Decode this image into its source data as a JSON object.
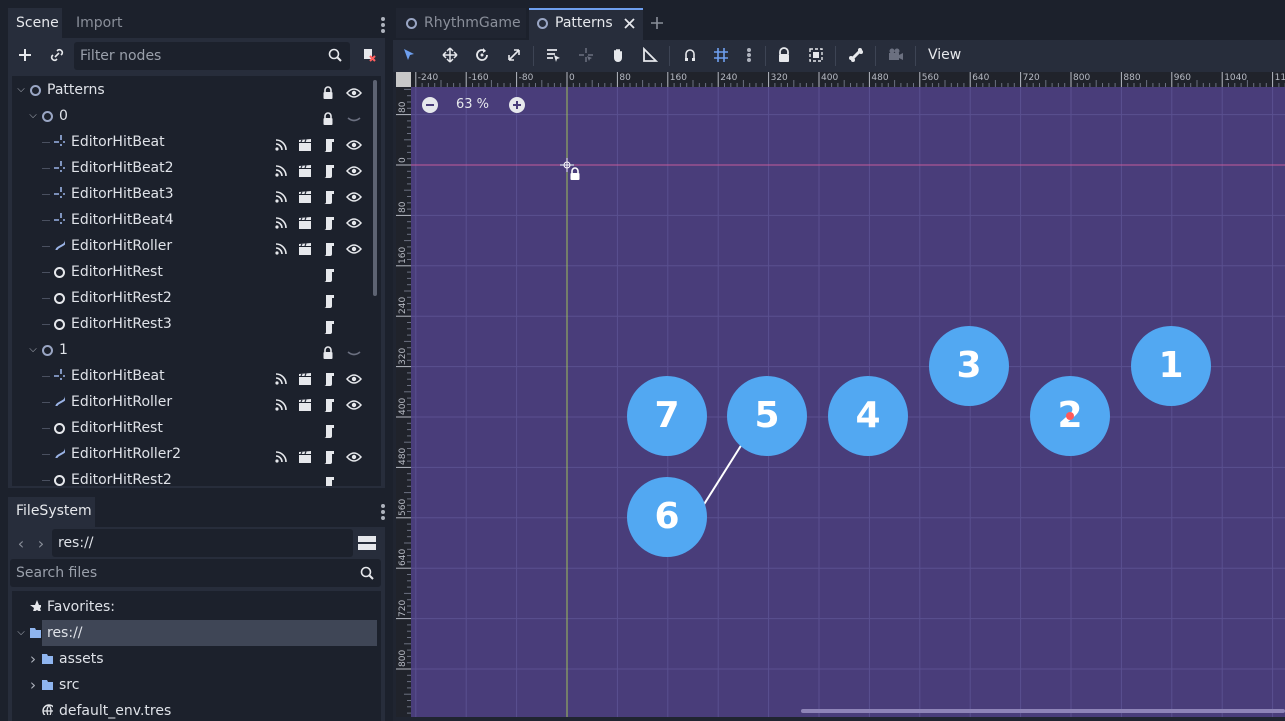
{
  "left_top_dock": {
    "tabs": [
      {
        "label": "Scene"
      },
      {
        "label": "Import"
      }
    ],
    "filter_placeholder": "Filter nodes",
    "tree": [
      {
        "label": "Patterns",
        "depth": 0,
        "caret": "down",
        "icon": "node2d-icon",
        "right_icons": [
          "lock-icon",
          "eye-icon"
        ]
      },
      {
        "label": "0",
        "depth": 1,
        "caret": "down",
        "icon": "node2d-icon",
        "right_icons": [
          "lock-icon",
          "hidden-eye-icon"
        ]
      },
      {
        "label": "EditorHitBeat",
        "depth": 2,
        "icon": "position2d-icon",
        "right_icons": [
          "signal-icon",
          "clapper-icon",
          "script-icon",
          "eye-icon"
        ]
      },
      {
        "label": "EditorHitBeat2",
        "depth": 2,
        "icon": "position2d-icon",
        "right_icons": [
          "signal-icon",
          "clapper-icon",
          "script-icon",
          "eye-icon"
        ]
      },
      {
        "label": "EditorHitBeat3",
        "depth": 2,
        "icon": "position2d-icon",
        "right_icons": [
          "signal-icon",
          "clapper-icon",
          "script-icon",
          "eye-icon"
        ]
      },
      {
        "label": "EditorHitBeat4",
        "depth": 2,
        "icon": "position2d-icon",
        "right_icons": [
          "signal-icon",
          "clapper-icon",
          "script-icon",
          "eye-icon"
        ]
      },
      {
        "label": "EditorHitRoller",
        "depth": 2,
        "icon": "path-icon",
        "right_icons": [
          "signal-icon",
          "clapper-icon",
          "script-icon",
          "eye-icon"
        ]
      },
      {
        "label": "EditorHitRest",
        "depth": 2,
        "icon": "node-icon",
        "right_icons": [
          "script-icon"
        ]
      },
      {
        "label": "EditorHitRest2",
        "depth": 2,
        "icon": "node-icon",
        "right_icons": [
          "script-icon"
        ]
      },
      {
        "label": "EditorHitRest3",
        "depth": 2,
        "icon": "node-icon",
        "right_icons": [
          "script-icon"
        ]
      },
      {
        "label": "1",
        "depth": 1,
        "caret": "down",
        "icon": "node2d-icon",
        "right_icons": [
          "lock-icon",
          "hidden-eye-icon"
        ]
      },
      {
        "label": "EditorHitBeat",
        "depth": 2,
        "icon": "position2d-icon",
        "right_icons": [
          "signal-icon",
          "clapper-icon",
          "script-icon",
          "eye-icon"
        ]
      },
      {
        "label": "EditorHitRoller",
        "depth": 2,
        "icon": "path-icon",
        "right_icons": [
          "signal-icon",
          "clapper-icon",
          "script-icon",
          "eye-icon"
        ]
      },
      {
        "label": "EditorHitRest",
        "depth": 2,
        "icon": "node-icon",
        "right_icons": [
          "script-icon"
        ]
      },
      {
        "label": "EditorHitRoller2",
        "depth": 2,
        "icon": "path-icon",
        "right_icons": [
          "signal-icon",
          "clapper-icon",
          "script-icon",
          "eye-icon"
        ]
      },
      {
        "label": "EditorHitRest2",
        "depth": 2,
        "icon": "node-icon",
        "right_icons": [
          "script-icon"
        ]
      }
    ]
  },
  "filesystem_dock": {
    "tab_label": "FileSystem",
    "path_value": "res://",
    "search_placeholder": "Search files",
    "tree": [
      {
        "label": "Favorites:",
        "depth": 0,
        "icon": "star-icon"
      },
      {
        "label": "res://",
        "depth": 0,
        "icon": "folder-icon",
        "caret": "down",
        "selected": true
      },
      {
        "label": "assets",
        "depth": 1,
        "icon": "folder-icon",
        "caret": "right"
      },
      {
        "label": "src",
        "depth": 1,
        "icon": "folder-icon",
        "caret": "right"
      },
      {
        "label": "default_env.tres",
        "depth": 1,
        "icon": "globe-icon"
      }
    ]
  },
  "editor_tabs": [
    {
      "label": "RhythmGame",
      "active": false
    },
    {
      "label": "Patterns",
      "active": true
    }
  ],
  "toolbar": {
    "view_label": "View",
    "tools": [
      "select-icon",
      "move-icon",
      "rotate-icon",
      "scale-icon",
      "list-select-icon",
      "pivot-icon",
      "pan-icon",
      "ruler-icon",
      "smart-snap-icon",
      "grid-snap-icon",
      "more-icon",
      "lock-icon",
      "group-icon",
      "bone-icon",
      "camera-icon"
    ]
  },
  "viewport": {
    "zoom_label": "63 %",
    "ruler_top": [
      "-240",
      "-160",
      "-80",
      "0",
      "80",
      "160",
      "240",
      "320",
      "400",
      "480",
      "560",
      "640",
      "720",
      "800",
      "880",
      "960",
      "1040",
      "11"
    ],
    "ruler_left": [
      "80",
      "0",
      "80",
      "160",
      "240",
      "320",
      "400",
      "480",
      "560",
      "640",
      "720",
      "800"
    ],
    "background_color": "#493d7a",
    "circle_color": "#52a8f2",
    "beats": [
      {
        "label": "1",
        "pos": "top-right"
      },
      {
        "label": "2",
        "pos": "right"
      },
      {
        "label": "3",
        "pos": "upper-middle"
      },
      {
        "label": "4",
        "pos": "middle"
      },
      {
        "label": "5",
        "pos": "middle-left"
      },
      {
        "label": "6",
        "pos": "lower-left"
      },
      {
        "label": "7",
        "pos": "left"
      }
    ]
  }
}
